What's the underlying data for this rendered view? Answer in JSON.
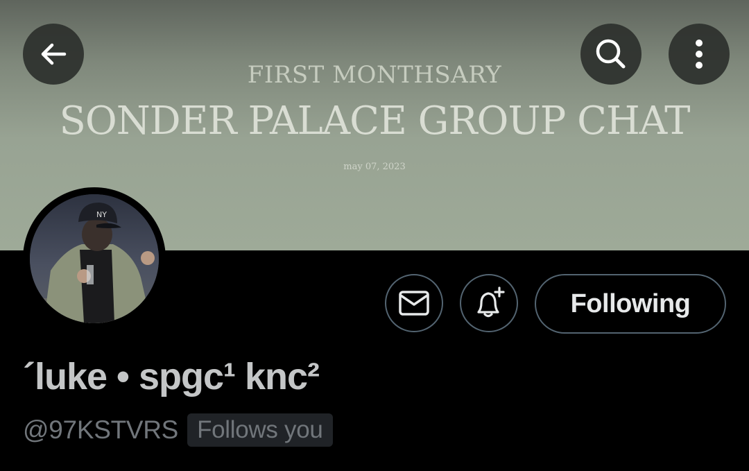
{
  "banner": {
    "subtitle": "FIRST MONTHSARY",
    "title": "SONDER PALACE GROUP CHAT",
    "date": "may 07, 2023"
  },
  "header": {
    "back_icon": "arrow-left-icon",
    "search_icon": "search-icon",
    "more_icon": "more-vertical-icon"
  },
  "actions": {
    "message_icon": "envelope-icon",
    "notify_icon": "bell-plus-icon",
    "following_label": "Following"
  },
  "profile": {
    "display_name": "´luke • spgc¹ knc²",
    "handle": "@97KSTVRS",
    "follows_you": "Follows you"
  },
  "colors": {
    "background": "#000000",
    "banner_top": "#5f655d",
    "banner_bottom": "#9eaa98",
    "text_primary": "#e7e9ea",
    "text_secondary": "#71767b",
    "button_border": "#536471"
  }
}
